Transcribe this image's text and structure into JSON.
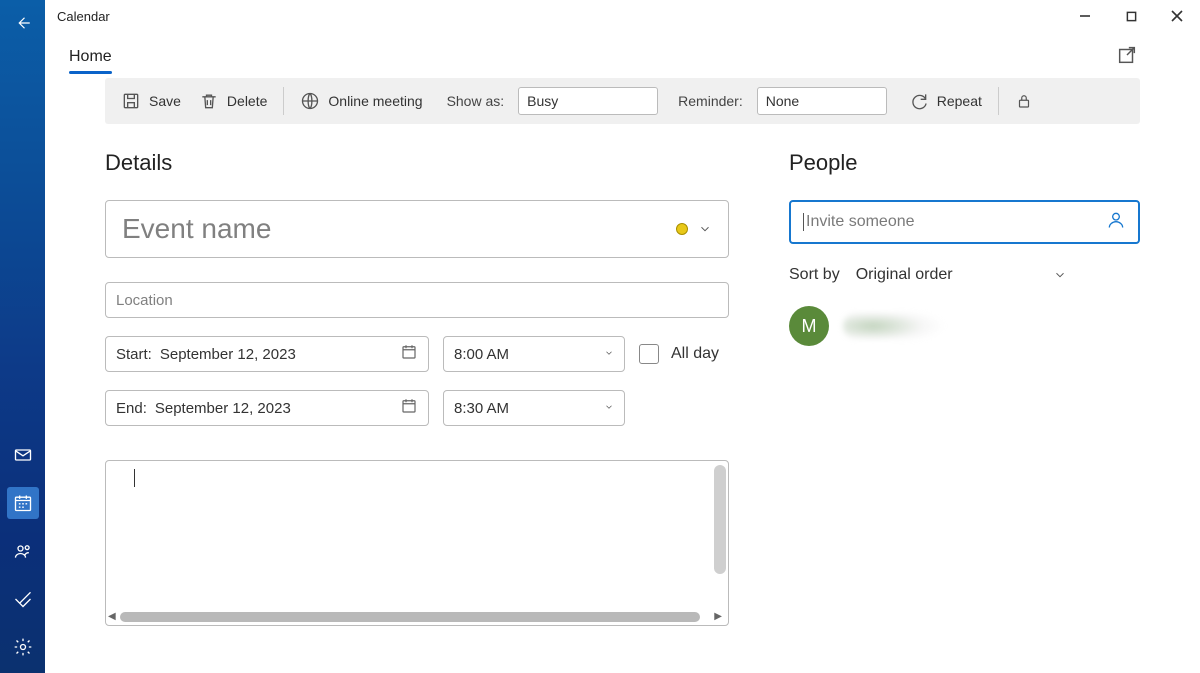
{
  "window": {
    "title": "Calendar"
  },
  "tabs": {
    "home": "Home"
  },
  "toolbar": {
    "save": "Save",
    "delete": "Delete",
    "online_meeting": "Online meeting",
    "show_as_label": "Show as:",
    "show_as_value": "Busy",
    "reminder_label": "Reminder:",
    "reminder_value": "None",
    "repeat": "Repeat"
  },
  "details": {
    "heading": "Details",
    "event_name_placeholder": "Event name",
    "location_placeholder": "Location",
    "start_label": "Start:",
    "start_date": "September 12, 2023",
    "start_time": "8:00 AM",
    "end_label": "End:",
    "end_date": "September 12, 2023",
    "end_time": "8:30 AM",
    "all_day": "All day"
  },
  "people": {
    "heading": "People",
    "invite_placeholder": "Invite someone",
    "sort_label": "Sort by",
    "sort_value": "Original order",
    "attendees": [
      {
        "initial": "M"
      }
    ]
  }
}
